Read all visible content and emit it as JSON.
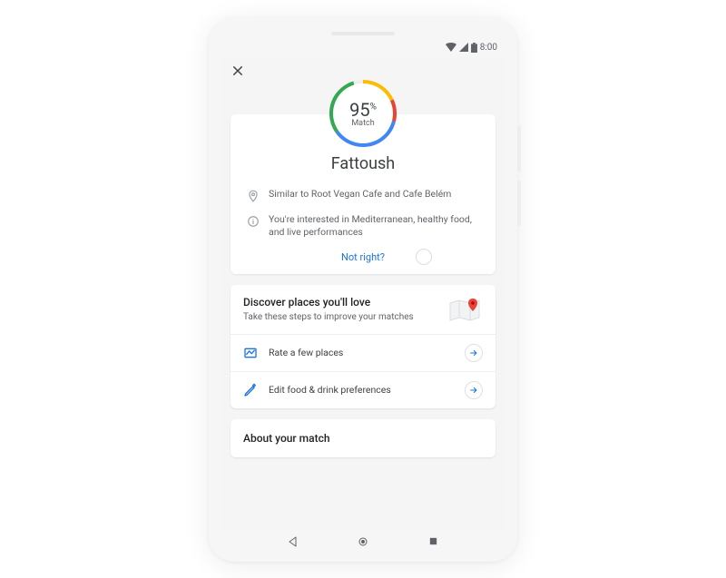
{
  "status": {
    "time": "8:00"
  },
  "match": {
    "percent": "95",
    "percent_symbol": "%",
    "label": "Match",
    "place_name": "Fattoush",
    "reasons": [
      "Similar to Root Vegan Cafe and Cafe Belém",
      "You're interested in Mediterranean, healthy food, and live performances"
    ],
    "not_right": "Not right?"
  },
  "discover": {
    "title": "Discover places you'll love",
    "subtitle": "Take these steps to improve your matches",
    "actions": {
      "rate": "Rate a few places",
      "edit": "Edit food & drink preferences"
    }
  },
  "about": {
    "title": "About your match"
  },
  "colors": {
    "blue": "#4285F4",
    "red": "#EA4335",
    "yellow": "#FBBC04",
    "green": "#34A853"
  }
}
